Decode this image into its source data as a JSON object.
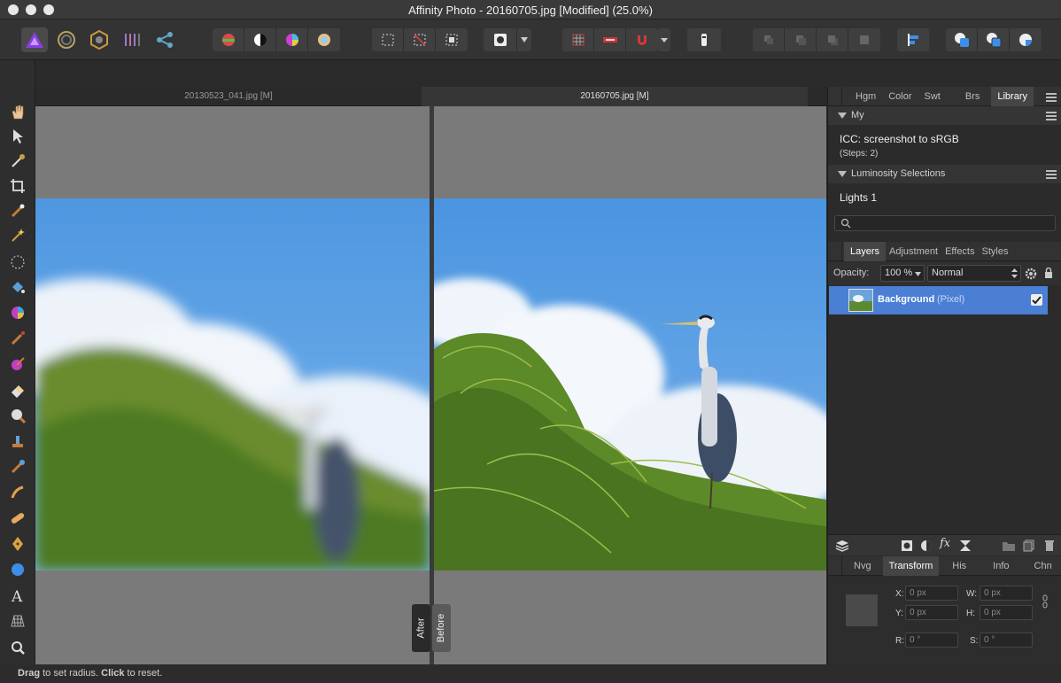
{
  "window": {
    "title": "Affinity Photo - 20160705.jpg [Modified] (25.0%)"
  },
  "doc_tabs": [
    {
      "label": "20130523_041.jpg [M]"
    },
    {
      "label": "20160705.jpg [M]"
    }
  ],
  "compare": {
    "after_label": "After",
    "before_label": "Before"
  },
  "studio_top": {
    "tabs": [
      "Hgm",
      "Color",
      "Swt",
      "Brs",
      "Library"
    ],
    "active_tab": "Library"
  },
  "library": {
    "section_my": "My",
    "macro_title": "ICC: screenshot to sRGB",
    "macro_steps": "(Steps: 2)",
    "section_luminosity": "Luminosity Selections",
    "item_lights": "Lights 1",
    "search_placeholder": ""
  },
  "layers_panel": {
    "tabs": [
      "Layers",
      "Adjustment",
      "Effects",
      "Styles"
    ],
    "active_tab": "Layers",
    "opacity_label": "Opacity:",
    "opacity_value": "100 %",
    "blend_mode": "Normal",
    "layer_name": "Background",
    "layer_type": "(Pixel)",
    "layer_checked": true
  },
  "transform_panel": {
    "tabs": [
      "Nvg",
      "Transform",
      "His",
      "Info",
      "Chn"
    ],
    "active_tab": "Transform",
    "x_label": "X:",
    "x_value": "0 px",
    "y_label": "Y:",
    "y_value": "0 px",
    "w_label": "W:",
    "w_value": "0 px",
    "h_label": "H:",
    "h_value": "0 px",
    "r_label": "R:",
    "r_value": "0 °",
    "s_label": "S:",
    "s_value": "0 °"
  },
  "status_bar": {
    "part1": "Drag",
    "part2": " to set radius. ",
    "part3": "Click",
    "part4": " to reset."
  },
  "colors": {
    "accent": "#4a7fd4",
    "persona_active": "#7a3fd0",
    "sky": "#5b9fe0"
  }
}
